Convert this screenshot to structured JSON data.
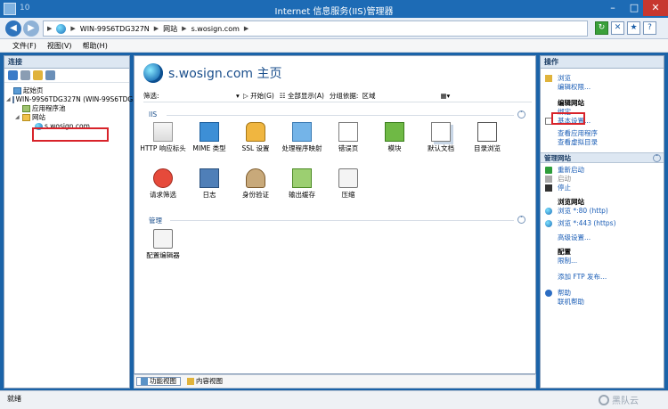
{
  "window": {
    "title": "Internet 信息服务(IIS)管理器",
    "number": "10"
  },
  "address": {
    "crumbs": [
      "WIN-99S6TDG327N",
      "网站",
      "s.wosign.com"
    ]
  },
  "menu": [
    "文件(F)",
    "视图(V)",
    "帮助(H)"
  ],
  "left": {
    "header": "连接",
    "tree": [
      {
        "label": "起始页",
        "depth": 0,
        "icon": "home-icon"
      },
      {
        "label": "WIN-99S6TDG327N (WIN-99S6TDG327N\\A",
        "depth": 0,
        "icon": "server-icon"
      },
      {
        "label": "应用程序池",
        "depth": 1,
        "icon": "app-pool-icon"
      },
      {
        "label": "网站",
        "depth": 1,
        "icon": "sites-folder-icon"
      },
      {
        "label": "s.wosign.com",
        "depth": 2,
        "icon": "globe-icon",
        "selected": true
      }
    ]
  },
  "center": {
    "title": "s.wosign.com 主页",
    "filter": {
      "label": "筛选:",
      "go": "开始(G)",
      "show_all": "全部显示(A)",
      "group_by": "分组依据:",
      "group_value": "区域"
    },
    "sections": [
      {
        "name": "IIS",
        "features": [
          {
            "label": "HTTP 响应标头",
            "icon": "http-headers-icon"
          },
          {
            "label": "MIME 类型",
            "icon": "mime-types-icon"
          },
          {
            "label": "SSL 设置",
            "icon": "ssl-lock-icon"
          },
          {
            "label": "处理程序映射",
            "icon": "handler-mappings-icon"
          },
          {
            "label": "错误页",
            "icon": "error-pages-icon"
          },
          {
            "label": "模块",
            "icon": "modules-icon"
          },
          {
            "label": "默认文档",
            "icon": "default-document-icon"
          },
          {
            "label": "目录浏览",
            "icon": "directory-browsing-icon"
          },
          {
            "label": "请求筛选",
            "icon": "request-filtering-icon"
          },
          {
            "label": "日志",
            "icon": "logging-icon"
          },
          {
            "label": "身份验证",
            "icon": "authentication-icon"
          },
          {
            "label": "输出缓存",
            "icon": "output-caching-icon"
          },
          {
            "label": "压缩",
            "icon": "compression-icon"
          }
        ]
      },
      {
        "name": "管理",
        "features": [
          {
            "label": "配置编辑器",
            "icon": "configuration-editor-icon"
          }
        ]
      }
    ],
    "view_tabs": [
      "功能视图",
      "内容视图"
    ]
  },
  "right": {
    "header": "操作",
    "groups": [
      {
        "title": null,
        "items": [
          {
            "label": "浏览",
            "style": "link",
            "icon": "explore-icon"
          },
          {
            "label": "编辑权限...",
            "style": "link",
            "icon": null
          }
        ]
      },
      {
        "title": "编辑网站",
        "items": [
          {
            "label": "绑定...",
            "style": "link",
            "icon": null,
            "highlight": true
          },
          {
            "label": "基本设置...",
            "style": "link",
            "icon": "basic-settings-icon"
          },
          {
            "label": "查看应用程序",
            "style": "link",
            "icon": null
          },
          {
            "label": "查看虚拟目录",
            "style": "link",
            "icon": null
          }
        ]
      },
      {
        "title": "管理网站",
        "header": true,
        "items": [
          {
            "label": "重新启动",
            "style": "link",
            "icon": "restart-icon"
          },
          {
            "label": "启动",
            "style": "disabled",
            "icon": "start-icon"
          },
          {
            "label": "停止",
            "style": "link",
            "icon": "stop-icon"
          }
        ]
      },
      {
        "title": "浏览网站",
        "items": [
          {
            "label": "浏览 *:80 (http)",
            "style": "link",
            "icon": "browse-http-icon"
          },
          {
            "label": "浏览 *:443 (https)",
            "style": "link",
            "icon": "browse-https-icon"
          },
          {
            "label": "高级设置...",
            "style": "link",
            "icon": null
          }
        ]
      },
      {
        "title": "配置",
        "items": [
          {
            "label": "限制...",
            "style": "link",
            "icon": null
          }
        ]
      },
      {
        "title": null,
        "items": [
          {
            "label": "添加 FTP 发布...",
            "style": "link",
            "icon": null
          }
        ]
      },
      {
        "title": null,
        "items": [
          {
            "label": "帮助",
            "style": "link",
            "icon": "help-icon"
          },
          {
            "label": "联机帮助",
            "style": "link",
            "icon": null
          }
        ]
      }
    ]
  },
  "status": "就绪",
  "watermark": "黑队云"
}
